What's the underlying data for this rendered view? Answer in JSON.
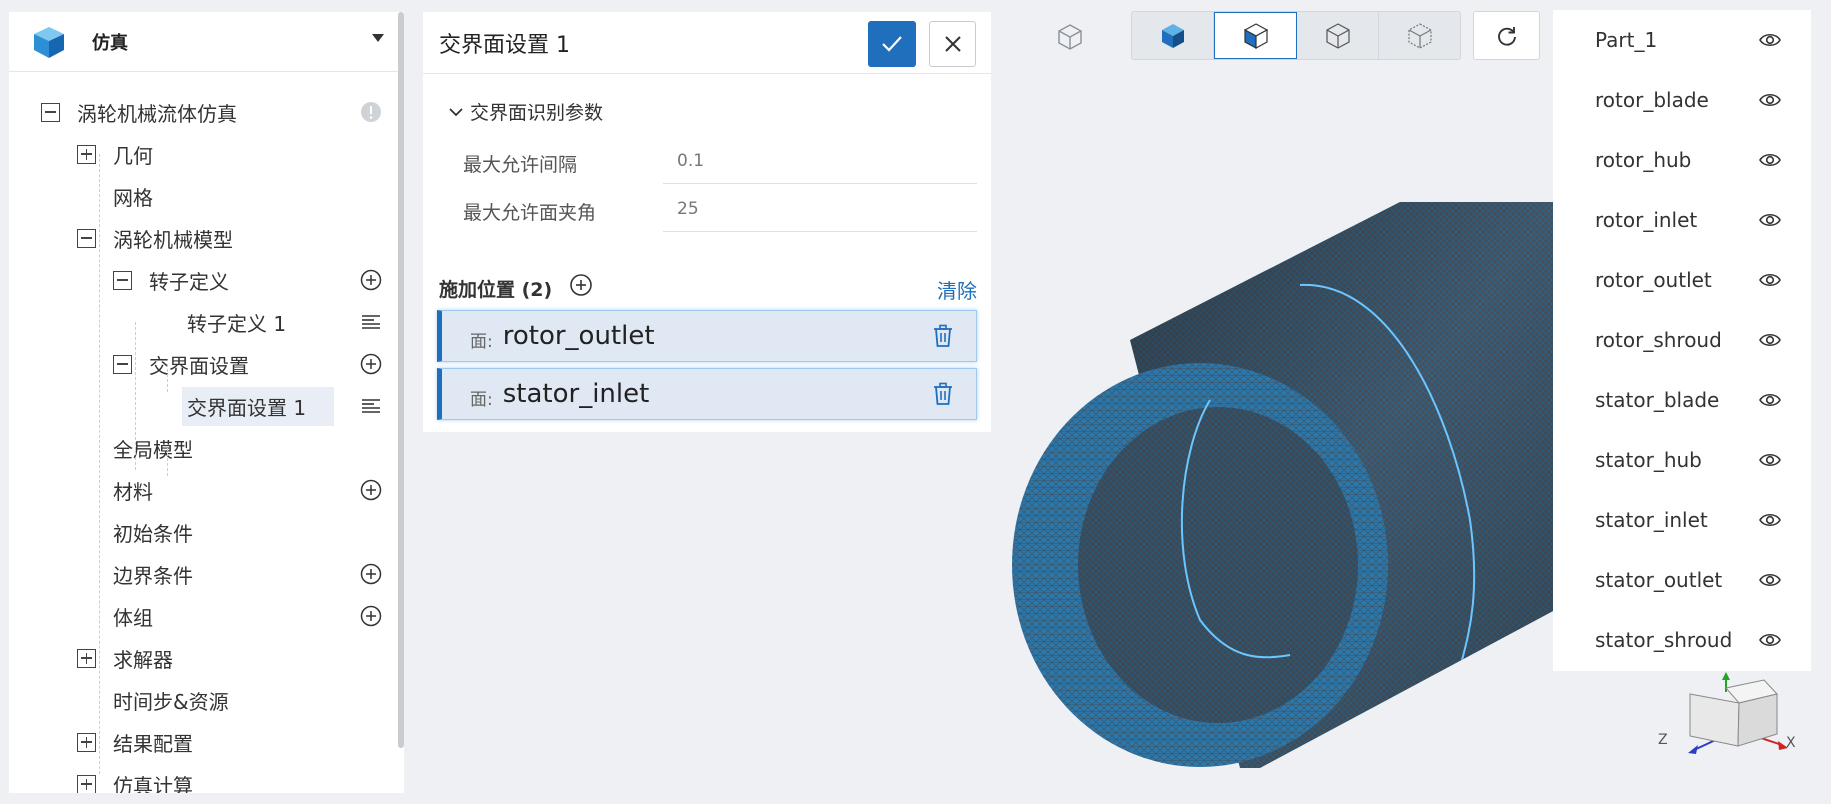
{
  "app": {
    "title": "仿真"
  },
  "tree": [
    {
      "label": "涡轮机械流体仿真",
      "expander": "minus",
      "action": "info"
    },
    {
      "label": "几何",
      "expander": "plus"
    },
    {
      "label": "网格"
    },
    {
      "label": "涡轮机械模型",
      "expander": "minus"
    },
    {
      "label": "转子定义",
      "expander": "minus",
      "action": "add"
    },
    {
      "label": "转子定义 1",
      "action": "menu"
    },
    {
      "label": "交界面设置",
      "expander": "minus",
      "action": "add"
    },
    {
      "label": "交界面设置 1",
      "action": "menu",
      "selected": true
    },
    {
      "label": "全局模型"
    },
    {
      "label": "材料",
      "action": "add"
    },
    {
      "label": "初始条件"
    },
    {
      "label": "边界条件",
      "action": "add"
    },
    {
      "label": "体组",
      "action": "add"
    },
    {
      "label": "求解器",
      "expander": "plus"
    },
    {
      "label": "时间步&资源"
    },
    {
      "label": "结果配置",
      "expander": "plus"
    },
    {
      "label": "仿真计算",
      "expander": "plus"
    }
  ],
  "settings": {
    "title": "交界面设置 1",
    "section": "交界面识别参数",
    "params": [
      {
        "label": "最大允许间隔",
        "value": "0.1"
      },
      {
        "label": "最大允许面夹角",
        "value": "25"
      }
    ],
    "apply": {
      "title": "施加位置 (2)",
      "clear": "清除"
    },
    "faces": [
      {
        "prefix": "面:",
        "name": "rotor_outlet"
      },
      {
        "prefix": "面:",
        "name": "stator_inlet"
      }
    ]
  },
  "parts": [
    "Part_1",
    "rotor_blade",
    "rotor_hub",
    "rotor_inlet",
    "rotor_outlet",
    "rotor_shroud",
    "stator_blade",
    "stator_hub",
    "stator_inlet",
    "stator_outlet",
    "stator_shroud"
  ],
  "axes": {
    "z": "Z",
    "x": "X"
  },
  "colors": {
    "accent": "#1f6fbd",
    "mesh": "#2a7bb3",
    "mesh_dark": "#3a4a58"
  },
  "icons": {
    "app": "cube-app-icon",
    "confirm": "check-icon",
    "close": "close-icon",
    "delete": "trash-icon",
    "visibility": "eye-icon",
    "reset": "refresh-icon"
  }
}
